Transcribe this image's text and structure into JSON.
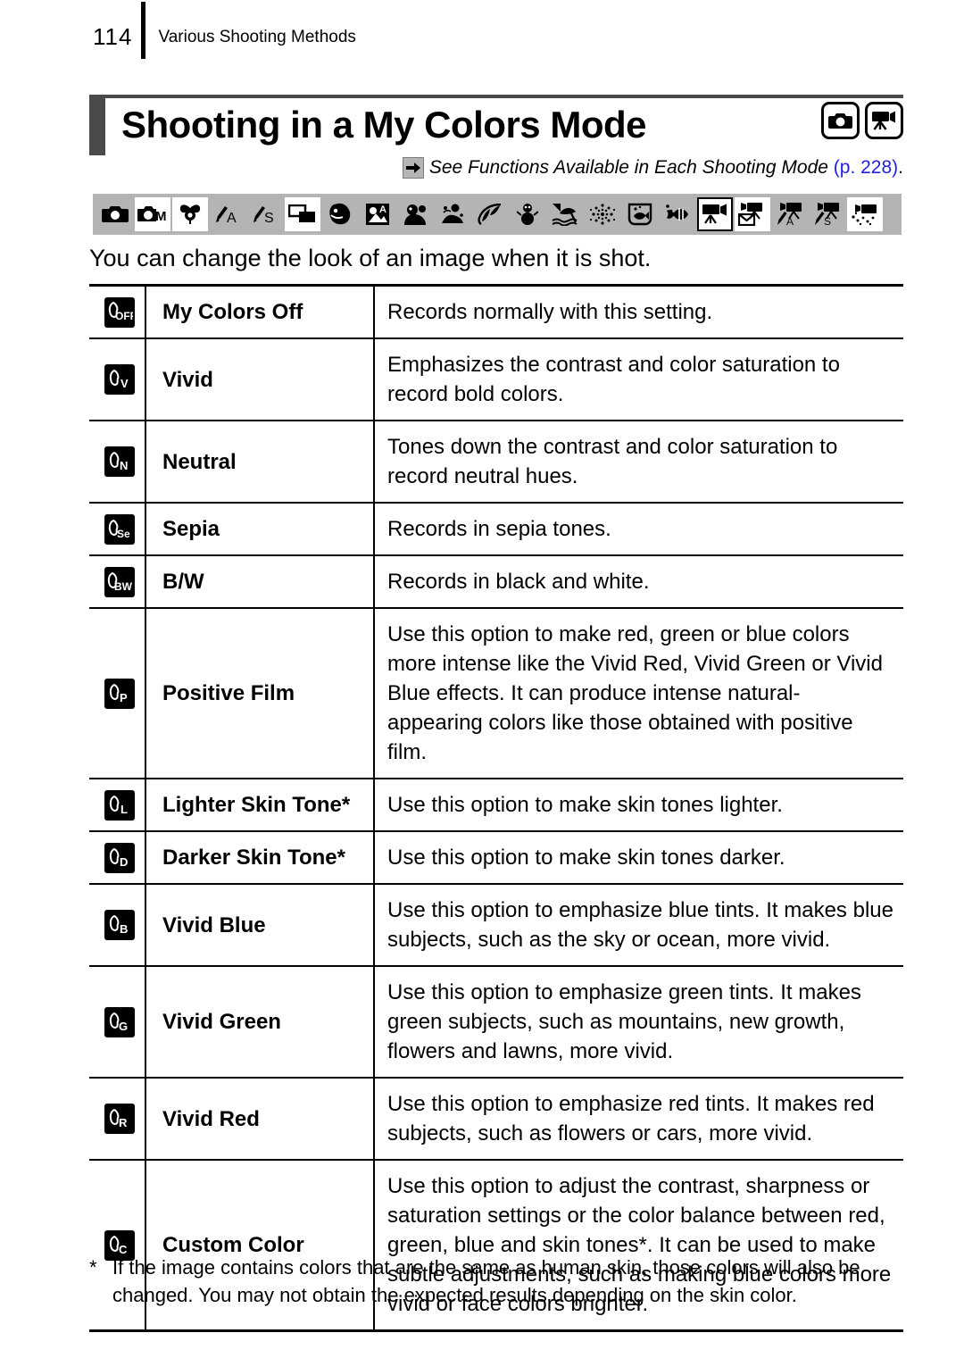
{
  "header": {
    "page_number": "114",
    "chapter": "Various Shooting Methods"
  },
  "title": {
    "heading": "Shooting in a My Colors Mode",
    "mode_icons": [
      "still-camera-icon",
      "movie-camera-icon"
    ]
  },
  "cross_reference": {
    "arrow": "arrow-right-icon",
    "text": "See Functions Available in Each Shooting Mode",
    "link": "(p. 228)",
    "period": ".",
    "link_color": "#2222dd"
  },
  "mode_strip": {
    "background": "#b4b4b4",
    "icons": [
      {
        "name": "auto-camera-icon",
        "state": "normal"
      },
      {
        "name": "manual-camera-icon",
        "state": "highlight"
      },
      {
        "name": "digital-macro-icon",
        "state": "highlight"
      },
      {
        "name": "aperture-priority-icon",
        "state": "normal"
      },
      {
        "name": "shutter-priority-icon",
        "state": "normal"
      },
      {
        "name": "stitch-assist-icon",
        "state": "highlight"
      },
      {
        "name": "portrait-icon",
        "state": "normal"
      },
      {
        "name": "night-snapshot-icon",
        "state": "normal"
      },
      {
        "name": "kids-and-pets-icon",
        "state": "normal"
      },
      {
        "name": "indoor-icon",
        "state": "normal"
      },
      {
        "name": "foliage-icon",
        "state": "normal"
      },
      {
        "name": "snow-icon",
        "state": "normal"
      },
      {
        "name": "beach-icon",
        "state": "normal"
      },
      {
        "name": "fireworks-icon",
        "state": "normal"
      },
      {
        "name": "aquarium-icon",
        "state": "normal"
      },
      {
        "name": "underwater-icon",
        "state": "normal"
      },
      {
        "name": "movie-standard-icon",
        "state": "boxed"
      },
      {
        "name": "movie-compact-icon",
        "state": "highlight"
      },
      {
        "name": "movie-aperture-icon",
        "state": "normal"
      },
      {
        "name": "movie-shutter-icon",
        "state": "normal"
      },
      {
        "name": "movie-color-accent-icon",
        "state": "highlight"
      }
    ]
  },
  "intro": "You can change the look of an image when it is shot.",
  "table": {
    "rows": [
      {
        "icon_label": "OFF",
        "icon_name": "my-colors-off-icon",
        "name": "My Colors Off",
        "description": "Records normally with this setting."
      },
      {
        "icon_label": "V",
        "icon_name": "vivid-icon",
        "name": "Vivid",
        "description": "Emphasizes the contrast and color saturation to record bold colors."
      },
      {
        "icon_label": "N",
        "icon_name": "neutral-icon",
        "name": "Neutral",
        "description": "Tones down the contrast and color saturation to record neutral hues."
      },
      {
        "icon_label": "Se",
        "icon_name": "sepia-icon",
        "name": "Sepia",
        "description": "Records in sepia tones."
      },
      {
        "icon_label": "BW",
        "icon_name": "black-and-white-icon",
        "name": "B/W",
        "description": "Records in black and white."
      },
      {
        "icon_label": "P",
        "icon_name": "positive-film-icon",
        "name": "Positive Film",
        "description": "Use this option to make red, green or blue colors more intense like the Vivid Red, Vivid Green or Vivid Blue effects. It can produce intense natural-appearing colors like those obtained with positive film."
      },
      {
        "icon_label": "L",
        "icon_name": "lighter-skin-tone-icon",
        "name": "Lighter Skin Tone*",
        "description": "Use this option to make skin tones lighter."
      },
      {
        "icon_label": "D",
        "icon_name": "darker-skin-tone-icon",
        "name": "Darker Skin Tone*",
        "description": "Use this option to make skin tones darker."
      },
      {
        "icon_label": "B",
        "icon_name": "vivid-blue-icon",
        "name": "Vivid Blue",
        "description": "Use this option to emphasize blue tints. It makes blue subjects, such as the sky or ocean, more vivid."
      },
      {
        "icon_label": "G",
        "icon_name": "vivid-green-icon",
        "name": "Vivid Green",
        "description": "Use this option to emphasize green tints. It makes green subjects, such as mountains, new growth, flowers and lawns, more vivid."
      },
      {
        "icon_label": "R",
        "icon_name": "vivid-red-icon",
        "name": "Vivid Red",
        "description": "Use this option to emphasize red tints. It makes red subjects, such as flowers or cars, more vivid."
      },
      {
        "icon_label": "C",
        "icon_name": "custom-color-icon",
        "name": "Custom Color",
        "description": "Use this option to adjust the contrast, sharpness or saturation settings or the color balance between red, green, blue and skin tones*. It can be used to make subtle adjustments, such as making blue colors more vivid or face colors brighter."
      }
    ]
  },
  "footnote": {
    "marker": "*",
    "text": "If the image contains colors that are the same as human skin, those colors will also be changed. You may not obtain the expected results depending on the skin color."
  }
}
